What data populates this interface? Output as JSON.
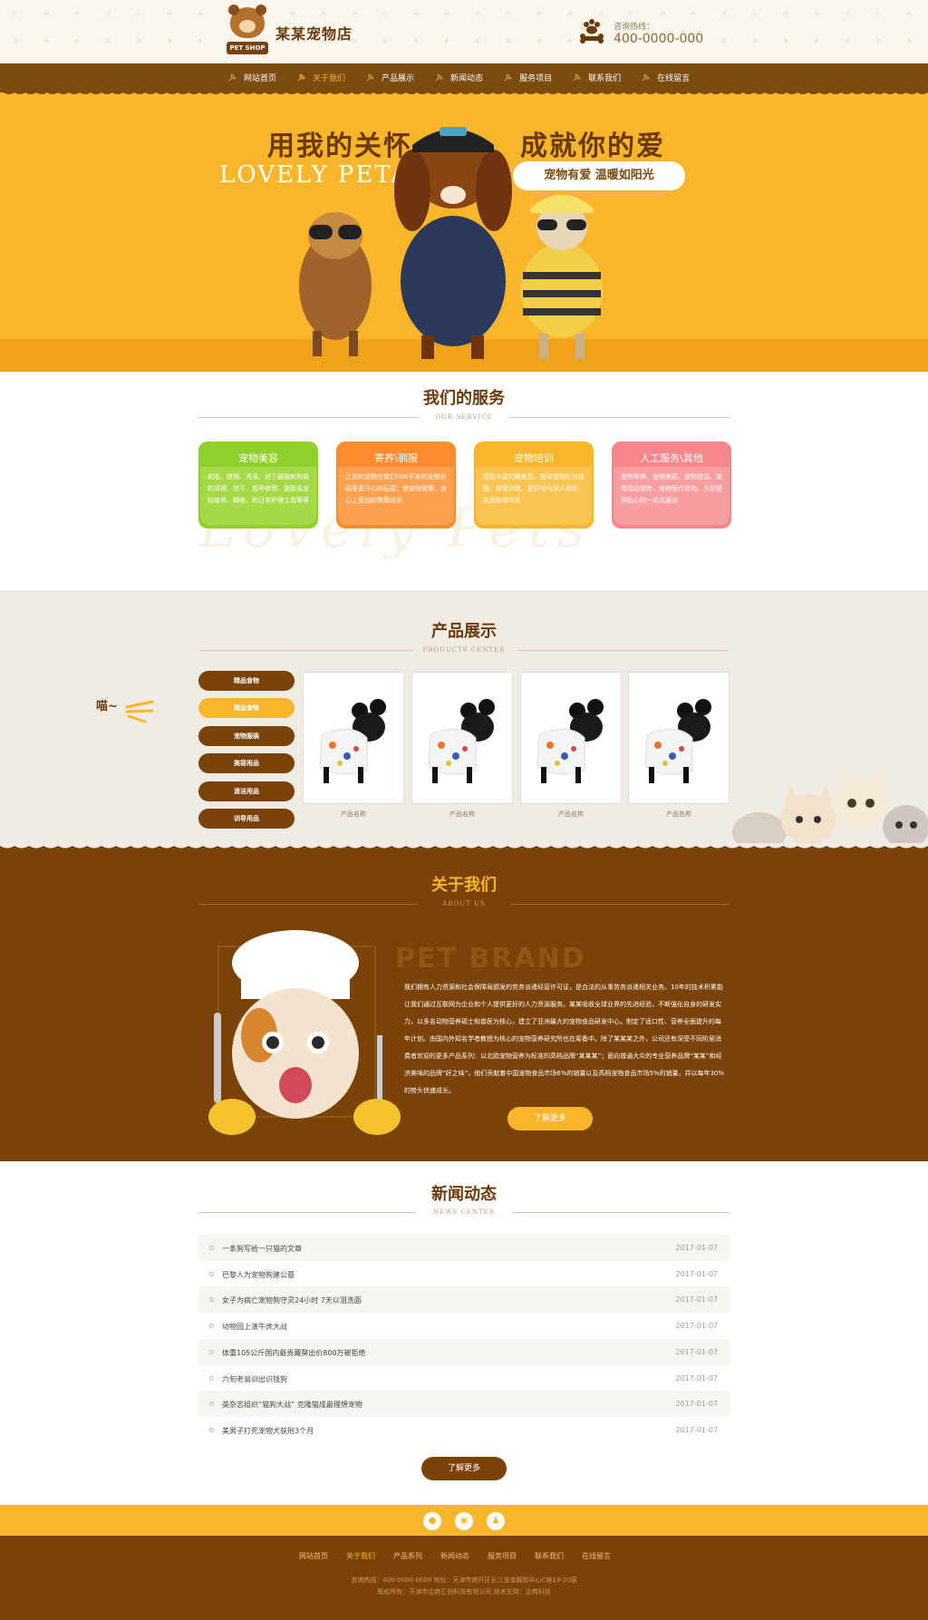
{
  "header": {
    "logo_tag": "PET SHOP",
    "store_name": "某某宠物店",
    "hotline_label": "咨询热线：",
    "hotline_number": "400-0000-000"
  },
  "nav": {
    "items": [
      {
        "label": "网站首页",
        "active": false
      },
      {
        "label": "关于我们",
        "active": true
      },
      {
        "label": "产品展示",
        "active": false
      },
      {
        "label": "新闻动态",
        "active": false
      },
      {
        "label": "服务项目",
        "active": false
      },
      {
        "label": "联系我们",
        "active": false
      },
      {
        "label": "在线留言",
        "active": false
      }
    ]
  },
  "banner": {
    "slogan_left": "用我的关怀",
    "slogan_right": "成就你的爱",
    "slogan_en": "LOVELY PETAS",
    "tagline": "宠物有爱  温暖如阳光"
  },
  "services": {
    "title": "我们的服务",
    "subtitle": "OUR SERVICE",
    "watermark": "Lovely Pets",
    "cards": [
      {
        "title": "宠物美容",
        "color": "#8fd12a",
        "body_color": "#a6d947",
        "text": "剃毛、梳理、洗澡、对于猫猫和狗染的清理、烘干、指甲修理、基础毛发的修剪、脚修、和日常护理工具等等"
      },
      {
        "title": "寄养\\驯服",
        "color": "#ff8c2e",
        "body_color": "#ffa04f",
        "text": "让您的宠物在我们500平米的宠物乐园里更开心的玩耍；使宠物健康、身心上更加的健康成长"
      },
      {
        "title": "宠物培训",
        "color": "#f9b52b",
        "body_color": "#fac451",
        "text": "经验丰富的教练员，指导宠物礼仪技能、排便训练、更好地与家人相处，实现和谐共处"
      },
      {
        "title": "人工服务\\其他",
        "color": "#f7878a",
        "body_color": "#f99ea0",
        "text": "宠物寄养、宠物美容、宠物接送、宠物用品销售、宠物医疗咨询、为您提供贴心的一站式服务"
      }
    ]
  },
  "products": {
    "title": "产品展示",
    "subtitle": "PRODUCTS CENTER",
    "meow": "喵~",
    "categories": [
      {
        "label": "精品食物",
        "active": false
      },
      {
        "label": "精品食物",
        "active": true
      },
      {
        "label": "宠物服装",
        "active": false
      },
      {
        "label": "美容用品",
        "active": false
      },
      {
        "label": "清洁用品",
        "active": false
      },
      {
        "label": "训导用品",
        "active": false
      }
    ],
    "items": [
      {
        "name": "产品名称"
      },
      {
        "name": "产品名称"
      },
      {
        "name": "产品名称"
      },
      {
        "name": "产品名称"
      }
    ]
  },
  "about": {
    "title": "关于我们",
    "subtitle": "ABOUT US",
    "brand": "PET BRAND",
    "text": "我们拥有人力资源和社会保障局颁发的劳务派遣经营许可证，是合法的从事劳务派遣相关业务。10年的技术积累能让我们通过互联网为企业和个人提供更好的人力资源服务。某某吸收全球业界的先进经验，不断强化自身的研发实力，以多名动物营养硕士和兽医为核心，建立了亚洲最大的宠物食品研发中心，制定了适口性、营养全面提升的每年计划。由国内外知名学者教授为核心的宠物营养研究所也在筹备中。除了某某某之外，公司还有深受不同阶层消费者欢迎的更多产品系列：以北欧宠物营养为标准的高档品牌“某某某”；面向普通大众的专业营养品牌“某某”和经济美味的品牌“好之味”，他们贡献着中国宠物食品市场6%的销量以及高档宠物食品市场5%的销量，并以每年30%的势头快速成长。",
    "button": "了解更多"
  },
  "news": {
    "title": "新闻动态",
    "subtitle": "NEWS CENTER",
    "items": [
      {
        "title": "一条狗写给一只猫的文章",
        "date": "2017-01-07"
      },
      {
        "title": "巴黎人为宠物狗建公墓",
        "date": "2017-01-07"
      },
      {
        "title": "女子为病亡宠物狗守灵24小时 7天以泪洗面",
        "date": "2017-01-07"
      },
      {
        "title": "动物园上演牛虎大战",
        "date": "2017-01-07"
      },
      {
        "title": "体重105公斤国内最贵藏獒出价800万被拒绝",
        "date": "2017-01-07"
      },
      {
        "title": "六旬老翁训出识钱狗",
        "date": "2017-01-07"
      },
      {
        "title": "英杂志组织“猫狗大战” 克隆猫成最理想宠物",
        "date": "2017-01-07"
      },
      {
        "title": "美男子打死宠物犬获刑3个月",
        "date": "2017-01-07"
      }
    ],
    "button": "了解更多"
  },
  "footer": {
    "icons": [
      "weibo-icon",
      "wechat-icon",
      "qq-icon"
    ],
    "nav": [
      {
        "label": "网站首页",
        "active": false
      },
      {
        "label": "关于我们",
        "active": true
      },
      {
        "label": "产品系列",
        "active": false
      },
      {
        "label": "新闻动态",
        "active": false
      },
      {
        "label": "服务项目",
        "active": false
      },
      {
        "label": "联系我们",
        "active": false
      },
      {
        "label": "在线留言",
        "active": false
      }
    ],
    "contact": "咨询热线：400-0000-0000    地址：天津市南开区长江道金融街中心C座19-20层",
    "copyright": "版权所有：天津市企商汇创科技有限公司          技术支持：企商科技"
  },
  "colors": {
    "brown": "#7b4208",
    "orange": "#f9b52b",
    "cream": "#f0ebe4"
  }
}
